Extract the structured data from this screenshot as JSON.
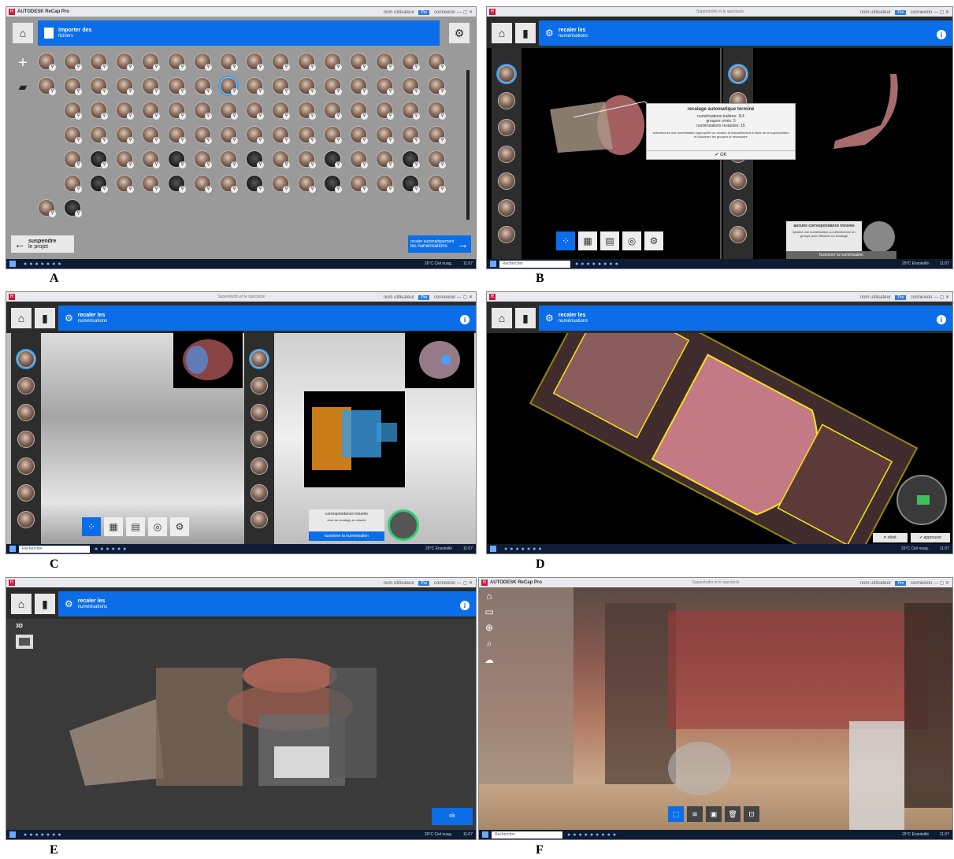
{
  "panels": {
    "a": {
      "label": "A",
      "titlebar": {
        "app": "AUTODESK ReCap Pro",
        "user": "nom utilisateur",
        "badge": "Pro",
        "signin": "connexion"
      },
      "import": {
        "title": "importer des",
        "subtitle": "fichiers"
      },
      "suspend": {
        "line1": "suspendre",
        "line2": "le projet"
      },
      "next": {
        "line1": "recaler automatiquement",
        "line2": "les numérisations"
      },
      "taskbar": {
        "weather": "26°C Ciel nuag.",
        "time": "11:07"
      }
    },
    "b": {
      "label": "B",
      "titlebar": {
        "center": "Superstudio et le spectacle",
        "user": "nom utilisateur",
        "badge": "Pro",
        "signin": "connexion"
      },
      "header": {
        "title": "recaler les",
        "subtitle": "numérisations"
      },
      "dialog": {
        "title": "recalage automatique terminé",
        "line1": "numérisations traitées: 114",
        "line2": "groupes créés: 5",
        "line3": "numérisations restantes: 15",
        "note": "sélectionnez une numérisation appropriée ou recalez-la manuellement à l'aide de la superposition et fusionnez les groupes si nécessaire",
        "ok": "OK"
      },
      "matchbox": {
        "title": "aucune correspondance trouvée",
        "body": "ajoutez une numérisation ou sélectionnez un groupe pour effectuer un recalage",
        "fuse": "fusionner la numérisation"
      },
      "taskbar": {
        "search": "Rechercher",
        "weather": "29°C Ensoleillé",
        "time": "11:07"
      }
    },
    "c": {
      "label": "C",
      "titlebar": {
        "center": "Superstudio et le spectacle",
        "user": "nom utilisateur",
        "badge": "Pro",
        "signin": "connexion"
      },
      "header": {
        "title": "recaler les",
        "subtitle": "numérisations"
      },
      "matchbox": {
        "title": "correspondance trouvée",
        "body": "cible de recalage en attente",
        "fuse": "fusionner la numérisation"
      },
      "taskbar": {
        "search": "Rechercher",
        "weather": "29°C Ensoleillé",
        "time": "11:07"
      }
    },
    "d": {
      "label": "D",
      "titlebar": {
        "user": "nom utilisateur",
        "badge": "Pro",
        "signin": "connexion"
      },
      "header": {
        "title": "recaler les",
        "subtitle": "numérisations"
      },
      "actions": {
        "reset": "réinit.",
        "approve": "approuver"
      },
      "taskbar": {
        "weather": "26°C Ciel nuag.",
        "time": "11:07"
      }
    },
    "e": {
      "label": "E",
      "titlebar": {
        "user": "nom utilisateur",
        "badge": "Pro",
        "signin": "connexion"
      },
      "header": {
        "title": "recaler les",
        "subtitle": "numérisations"
      },
      "view": {
        "mode": "3D"
      },
      "ok": "ok",
      "taskbar": {
        "weather": "26°C Ciel nuag.",
        "time": "11:07"
      }
    },
    "f": {
      "label": "F",
      "titlebar": {
        "app": "AUTODESK ReCap Pro",
        "center": "Superstudio et le spectacle",
        "user": "nom utilisateur",
        "badge": "Pro",
        "signin": "connexion"
      },
      "taskbar": {
        "search": "Rechercher",
        "weather": "29°C Ensoleillé",
        "time": "11:07"
      }
    }
  },
  "colors": {
    "accent": "#0b6ee8",
    "selection": "#2ea2ff",
    "outline": "#f5e21c"
  }
}
